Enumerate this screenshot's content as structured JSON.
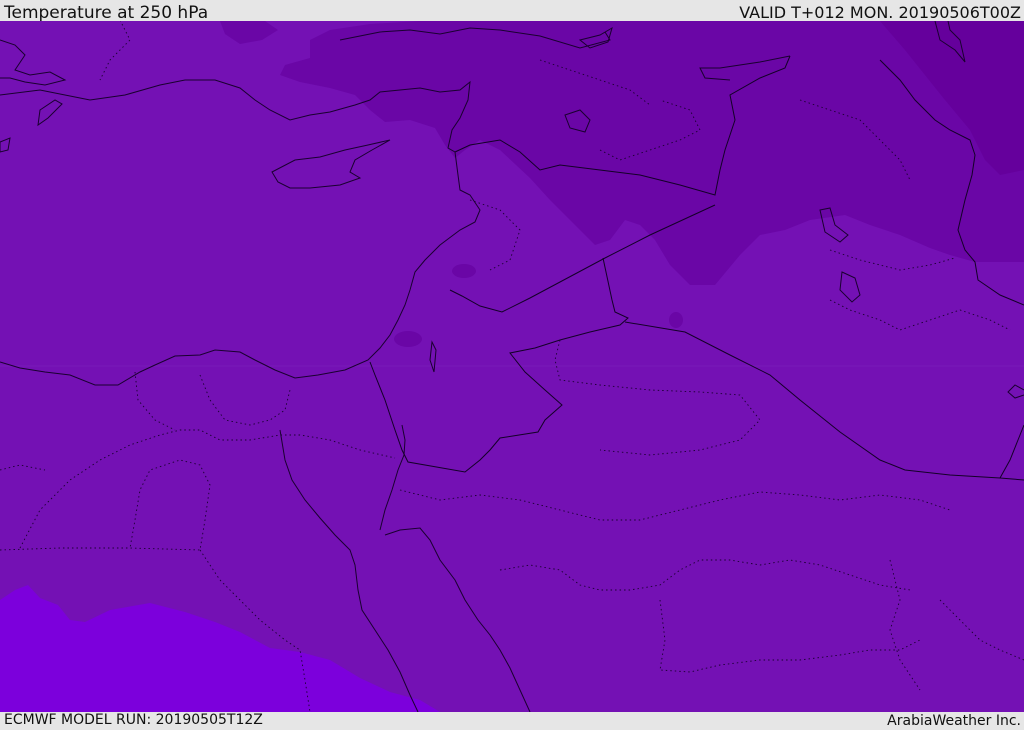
{
  "header": {
    "title": "Temperature at 250 hPa",
    "valid_time": "VALID T+012 MON. 20190506T00Z"
  },
  "footer": {
    "model_run": "ECMWF MODEL RUN: 20190505T12Z",
    "credit": "ArabiaWeather Inc."
  },
  "map": {
    "colors": {
      "base_field": "#7411b4",
      "cold_band": "#6a06a6",
      "coldest_band": "#65009c",
      "warm_band": "#7c00dc",
      "coastline": "#1a0030",
      "border": "#140028"
    }
  }
}
